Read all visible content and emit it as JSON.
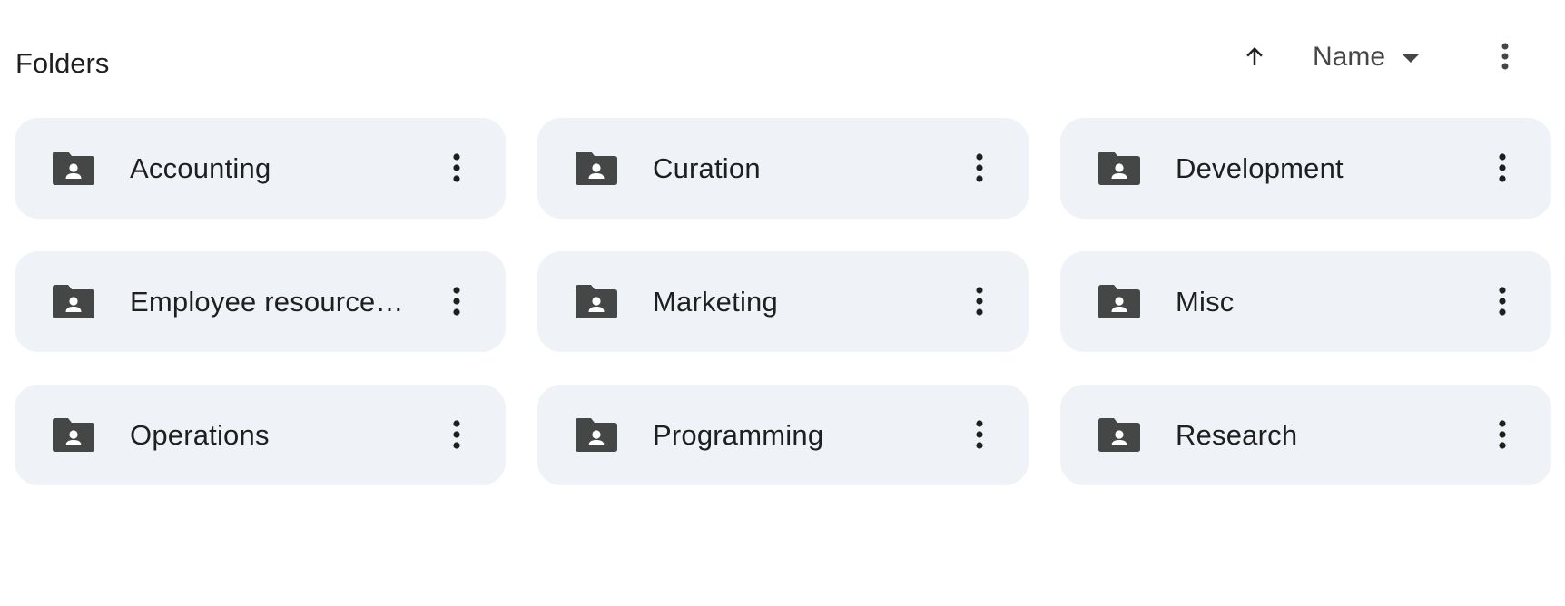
{
  "header": {
    "title": "Folders",
    "sort_direction_icon": "arrow-upward-icon",
    "sort_field_label": "Name",
    "sort_dropdown_icon": "arrow-drop-down-icon",
    "more_icon": "more-vert-icon"
  },
  "folders": [
    {
      "name": "Accounting",
      "icon": "shared-folder-icon"
    },
    {
      "name": "Curation",
      "icon": "shared-folder-icon"
    },
    {
      "name": "Development",
      "icon": "shared-folder-icon"
    },
    {
      "name": "Employee resource…",
      "icon": "shared-folder-icon"
    },
    {
      "name": "Marketing",
      "icon": "shared-folder-icon"
    },
    {
      "name": "Misc",
      "icon": "shared-folder-icon"
    },
    {
      "name": "Operations",
      "icon": "shared-folder-icon"
    },
    {
      "name": "Programming",
      "icon": "shared-folder-icon"
    },
    {
      "name": "Research",
      "icon": "shared-folder-icon"
    }
  ],
  "colors": {
    "card_background": "#eff2f7",
    "icon": "#444746",
    "text": "#1f1f1f"
  }
}
